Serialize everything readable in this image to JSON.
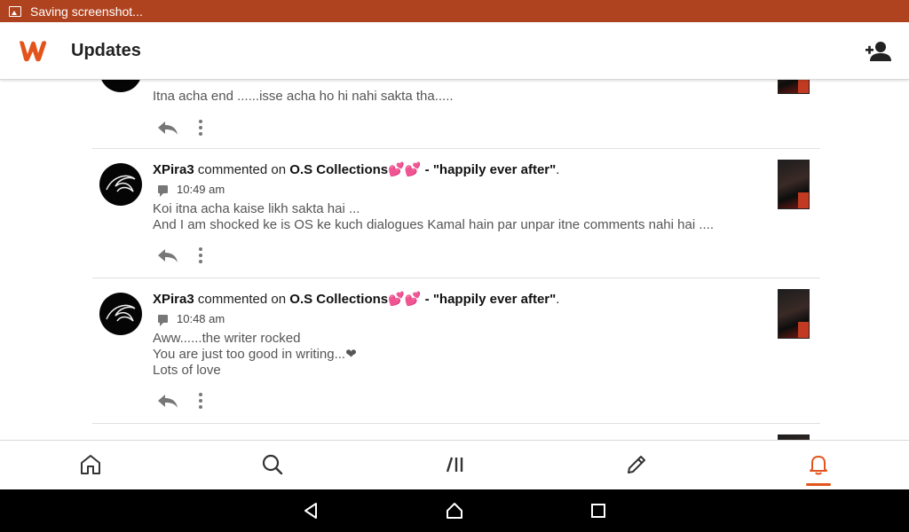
{
  "status_bar": {
    "text": "Saving screenshot..."
  },
  "app_bar": {
    "title": "Updates"
  },
  "colors": {
    "brand": "#e2541b",
    "status_bar": "#b0431f"
  },
  "partial_item": {
    "body": "Itna acha end ......isse acha ho hi nahi sakta tha....."
  },
  "items": [
    {
      "user": "XPira3",
      "action": "commented on",
      "story": "O.S Collections💕💕 - \"happily ever after\"",
      "period": ".",
      "time": "10:49 am",
      "lines": [
        "Koi itna acha kaise likh sakta hai ...",
        "And I am shocked ke is OS ke kuch dialogues Kamal hain par unpar itne comments nahi hai ...."
      ]
    },
    {
      "user": "XPira3",
      "action": "commented on",
      "story": "O.S Collections💕💕 - \"happily ever after\"",
      "period": ".",
      "time": "10:48 am",
      "lines": [
        "Aww......the writer rocked",
        "You are just too good in writing...❤",
        "Lots of love"
      ]
    }
  ],
  "bottom_nav": [
    "home-icon",
    "search-icon",
    "library-icon",
    "write-icon",
    "notifications-icon"
  ],
  "system_nav": [
    "back-icon",
    "home-icon",
    "recents-icon"
  ]
}
